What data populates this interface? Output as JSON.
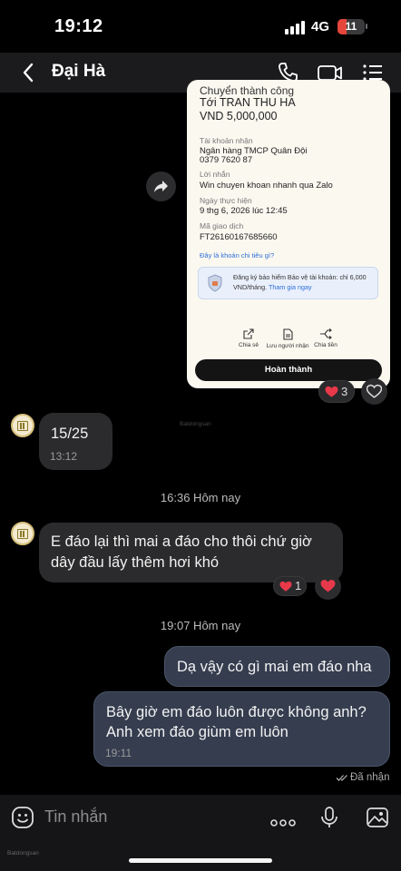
{
  "status_bar": {
    "time": "19:12",
    "network": "4G",
    "battery": "11"
  },
  "header": {
    "contact_name": "Đại Hà"
  },
  "receipt": {
    "heading_partial": "Chuyển thành công",
    "recipient_line": "Tới TRAN THU HA",
    "amount": "VND 5,000,000",
    "account_label": "Tài khoản nhận",
    "bank": "Ngân hàng TMCP Quân Đội",
    "account_number": "0379 7620 87",
    "note_label": "Lời nhắn",
    "note": "Win chuyen khoan nhanh qua Zalo",
    "date_label": "Ngày thực hiện",
    "date": "9 thg 6, 2026 lúc 12:45",
    "txn_label": "Mã giao dịch",
    "txn_id": "FT26160167685660",
    "detail_link": "Đây là khoản chi tiêu gì?",
    "insurance_text": "Đăng ký bảo hiểm Bảo vệ tài khoản: chỉ 6,000 VND/tháng.",
    "insurance_link": "Tham gia ngay",
    "actions": [
      "Chia sẻ",
      "Lưu người nhận",
      "Chia tiền"
    ],
    "done_button": "Hoàn thành"
  },
  "reactions": {
    "receipt_count": "3",
    "msg2_count": "1"
  },
  "messages": [
    {
      "text": "15/25",
      "time": "13:12"
    },
    {
      "text_line1": "E đáo lại thì mai a đáo cho thôi chứ giờ",
      "text_line2": "dây đầu lấy thêm hơi khó"
    },
    {
      "text": "Dạ vậy có gì mai em đáo nha"
    },
    {
      "text_line1": "Bây giờ em đáo luôn được không anh?",
      "text_line2": "Anh xem đáo giùm em luôn",
      "time": "19:11"
    }
  ],
  "dividers": [
    "16:36 Hôm nay",
    "19:07 Hôm nay"
  ],
  "seen_status": "Đã nhận",
  "watermark": "Batdongsan",
  "composer": {
    "placeholder": "Tin nhắn"
  },
  "colors": {
    "background": "#000000",
    "incoming_bubble": "#2b2b2d",
    "outgoing_bubble": "#353d4f",
    "heart": "#e8394a"
  }
}
